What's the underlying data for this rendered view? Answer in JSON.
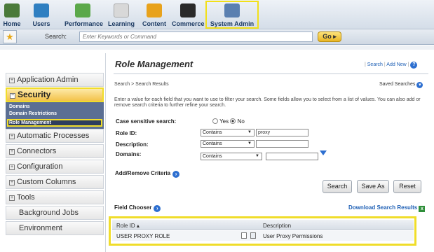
{
  "topnav": {
    "items": [
      {
        "label": "Home",
        "icon": "home-icon",
        "color": "#4a7a3a"
      },
      {
        "label": "Users",
        "icon": "users-icon",
        "color": "#2f7fc1"
      },
      {
        "label": "Performance",
        "icon": "performance-icon",
        "color": "#5ba84a"
      },
      {
        "label": "Learning",
        "icon": "learning-icon",
        "color": "#c9c9c9"
      },
      {
        "label": "Content",
        "icon": "content-icon",
        "color": "#e8a21c"
      },
      {
        "label": "Commerce",
        "icon": "commerce-icon",
        "color": "#2a2a2a"
      },
      {
        "label": "System Admin",
        "icon": "system-admin-icon",
        "color": "#5a7fb0"
      }
    ]
  },
  "search": {
    "label": "Search:",
    "placeholder": "Enter Keywords or Command",
    "go": "Go ▸"
  },
  "sidebar": {
    "items": [
      {
        "label": "Application Admin",
        "toggle": "+"
      },
      {
        "label": "Security",
        "toggle": "−"
      },
      {
        "label": "Automatic Processes",
        "toggle": "+"
      },
      {
        "label": "Connectors",
        "toggle": "+"
      },
      {
        "label": "Configuration",
        "toggle": "+"
      },
      {
        "label": "Custom Columns",
        "toggle": "+"
      },
      {
        "label": "Tools",
        "toggle": "+"
      },
      {
        "label": "Background Jobs",
        "toggle": ""
      },
      {
        "label": "Environment",
        "toggle": ""
      }
    ],
    "security_links": [
      "Domains",
      "Domain Restrictions",
      "Role Management"
    ]
  },
  "main": {
    "title": "Role Management",
    "links": {
      "search": "Search",
      "add_new": "Add New",
      "help": "?"
    },
    "breadcrumb": "Search > Search Results",
    "saved_searches": "Saved Searches",
    "instructions": "Enter a value for each field that you want to use to filter your search. Some fields allow you to select from a list of values. You can also add or remove search criteria to further refine your search.",
    "case_label": "Case sensitive search:",
    "case_yes": "Yes",
    "case_no": "No",
    "role_id_label": "Role ID:",
    "role_id_op": "Contains",
    "role_id_value": "proxy",
    "desc_label": "Description:",
    "desc_op": "Contains",
    "domains_label": "Domains:",
    "domains_op": "Contains",
    "add_remove": "Add/Remove Criteria",
    "buttons": {
      "search": "Search",
      "save_as": "Save As",
      "reset": "Reset"
    },
    "field_chooser": "Field Chooser",
    "download": "Download Search Results",
    "table": {
      "headers": [
        "Role ID ▴",
        "Description"
      ],
      "rows": [
        {
          "role_id": "USER PROXY ROLE",
          "description": "User Proxy Permissions"
        }
      ]
    }
  }
}
